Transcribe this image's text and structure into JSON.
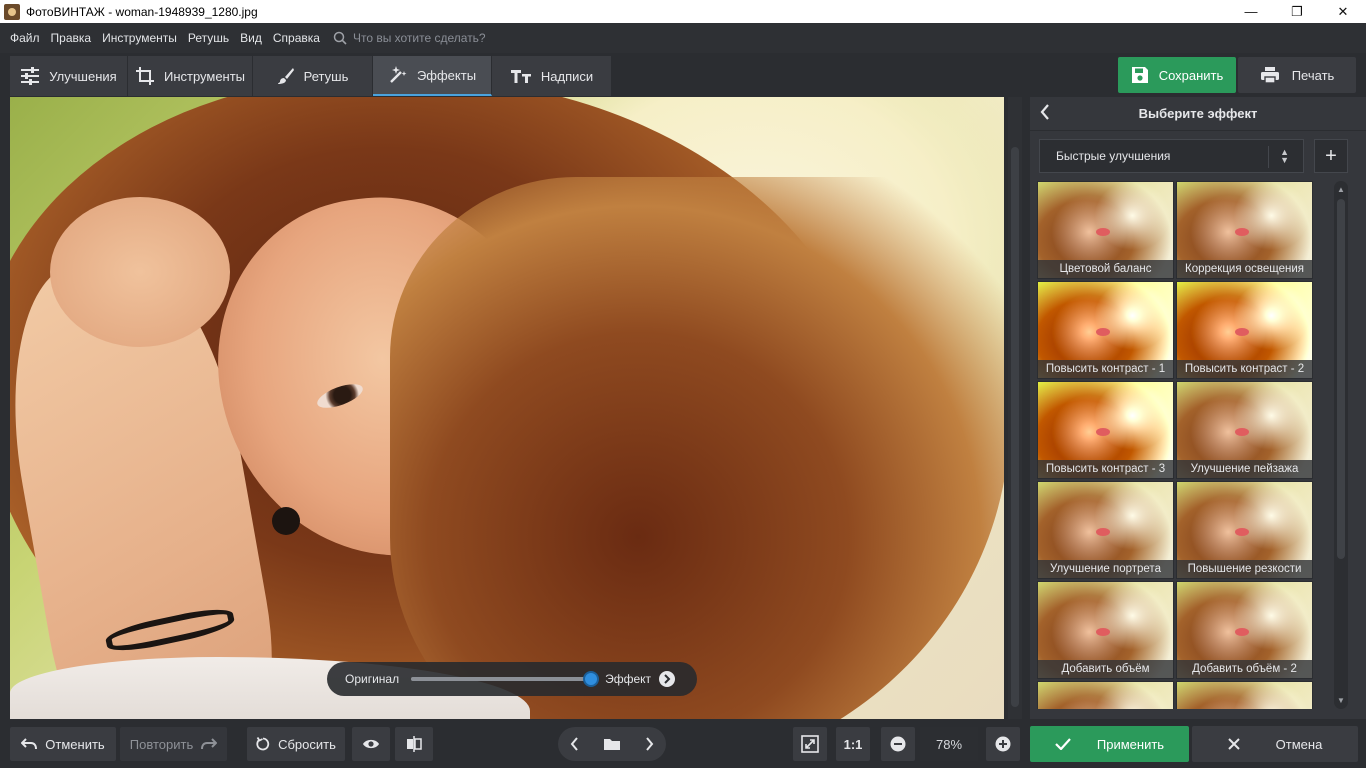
{
  "window": {
    "title": "ФотоВИНТАЖ - woman-1948939_1280.jpg",
    "minimize": "—",
    "maximize": "❐",
    "close": "✕"
  },
  "menu": {
    "items": [
      "Файл",
      "Правка",
      "Инструменты",
      "Ретушь",
      "Вид",
      "Справка"
    ],
    "search_placeholder": "Что вы хотите сделать?"
  },
  "tabs": [
    {
      "label": "Улучшения",
      "icon": "sliders-icon"
    },
    {
      "label": "Инструменты",
      "icon": "crop-icon"
    },
    {
      "label": "Ретушь",
      "icon": "brush-icon"
    },
    {
      "label": "Эффекты",
      "icon": "magic-wand-icon",
      "active": true
    },
    {
      "label": "Надписи",
      "icon": "text-icon"
    }
  ],
  "actions": {
    "save_label": "Сохранить",
    "print_label": "Печать"
  },
  "compare": {
    "original_label": "Оригинал",
    "effect_label": "Эффект",
    "position": 0.98
  },
  "panel": {
    "title": "Выберите эффект",
    "category": "Быстрые улучшения",
    "effects": [
      "Цветовой баланс",
      "Коррекция освещения",
      "Повысить контраст - 1",
      "Повысить контраст - 2",
      "Повысить контраст - 3",
      "Улучшение пейзажа",
      "Улучшение портрета",
      "Повышение резкости",
      "Добавить объём",
      "Добавить объём - 2",
      "",
      ""
    ]
  },
  "bottom": {
    "undo_label": "Отменить",
    "redo_label": "Повторить",
    "reset_label": "Сбросить",
    "ratio_label": "1:1",
    "zoom": "78%",
    "apply_label": "Применить",
    "cancel_label": "Отмена"
  },
  "colors": {
    "accent_green": "#2b9a5b",
    "accent_blue": "#2f8ede",
    "panel_bg": "#35373c",
    "app_bg": "#2b2d31"
  }
}
